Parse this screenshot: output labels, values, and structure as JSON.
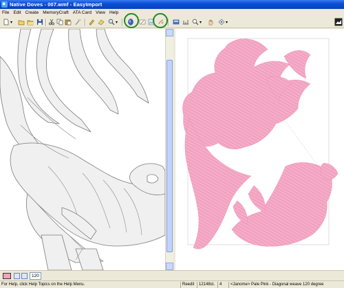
{
  "window": {
    "title": "Native Doves - 007.wmf - EasyImport"
  },
  "menu": {
    "items": [
      "File",
      "Edit",
      "Create",
      "MemoryCraft",
      "ATA Card",
      "View",
      "Help"
    ]
  },
  "toolbar": {
    "icons": [
      "new-icon",
      "open-icon",
      "open-folder-icon",
      "save-icon",
      "cut-icon",
      "copy-icon",
      "paste-icon",
      "wand-icon",
      "pencil-icon",
      "eraser-icon",
      "zoom-icon",
      "oval-select-icon",
      "fill-icon",
      "image-icon",
      "scanner-icon",
      "view-icon",
      "measure-icon",
      "zoom-view-icon",
      "palette-icon"
    ],
    "highlight_color": "#1f8a1f"
  },
  "colors": {
    "thread_color": "#f2a1c0",
    "outline_fill": "#f0f0f0",
    "titlebar": "#0a4fd6"
  },
  "swatchbar": {
    "number": "120"
  },
  "statusbar": {
    "help": "For Help, click Help Topics on the Help Menu.",
    "mode": "Reedit",
    "stitches": "12148st.",
    "count": "4",
    "thread": "<Janome> Pale Pink - Diagonal weave 120 degree"
  }
}
